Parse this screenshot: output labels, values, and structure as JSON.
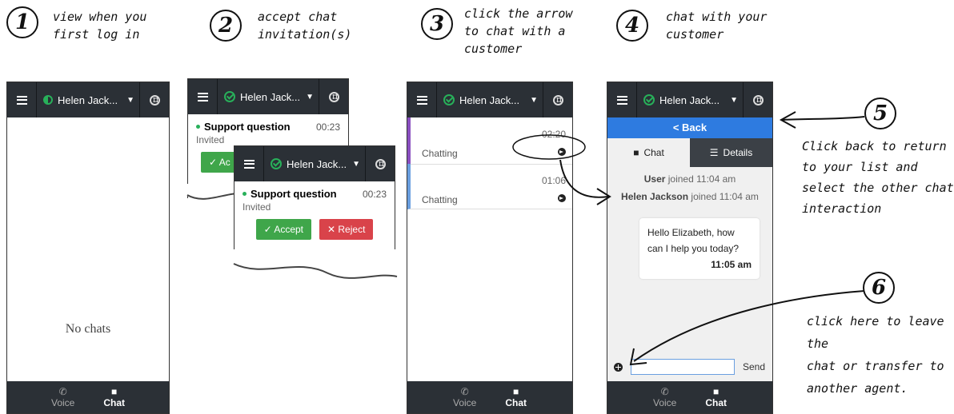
{
  "app": {
    "user_name": "Helen Jack...",
    "colors": {
      "topbar": "#2b3036",
      "status_green": "#28b05a",
      "back_blue": "#2e7be0",
      "accept": "#3fa64a",
      "reject": "#d9434a"
    }
  },
  "steps": [
    {
      "num": "1",
      "caption_lines": [
        "view when you",
        "first log in"
      ]
    },
    {
      "num": "2",
      "caption_lines": [
        "accept chat",
        "invitation(s)"
      ]
    },
    {
      "num": "3",
      "caption_lines": [
        "click the arrow",
        "to chat with a",
        "customer"
      ]
    },
    {
      "num": "4",
      "caption_lines": [
        "chat with your",
        "customer"
      ]
    }
  ],
  "bottom_nav": {
    "voice": "Voice",
    "chat": "Chat",
    "icons": [
      "phone-icon",
      "chat-bubble-icon"
    ]
  },
  "panel1": {
    "empty_text": "No chats"
  },
  "invitation": {
    "title": "Support question",
    "time": "00:23",
    "status": "Invited",
    "accept_label": "Accept",
    "reject_label": "Reject",
    "accept_partial": "Ac"
  },
  "panel3": {
    "rows": [
      {
        "time": "02:20",
        "status": "Chatting"
      },
      {
        "time": "01:06",
        "status": "Chatting"
      }
    ]
  },
  "panel4": {
    "back_label": "< Back",
    "tab_chat": "Chat",
    "tab_details": "Details",
    "sys_user_name": "User",
    "sys_user_text": " joined 11:04 am",
    "sys_agent_name": "Helen Jackson",
    "sys_agent_text": " joined 11:04 am",
    "message_line1": "Hello Elizabeth, how",
    "message_line2": "can I help you today?",
    "message_time": "11:05 am",
    "send_label": "Send"
  },
  "callouts": [
    {
      "num": "5",
      "lines": [
        "Click back to return",
        "to your list and",
        "select the other chat",
        "interaction"
      ]
    },
    {
      "num": "6",
      "lines": [
        "click here to leave the",
        "chat or transfer to",
        "another agent."
      ]
    }
  ]
}
